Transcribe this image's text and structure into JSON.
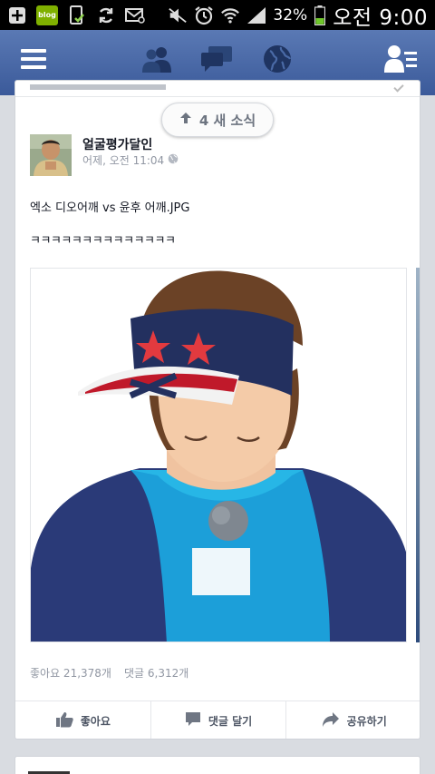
{
  "status_bar": {
    "battery": "32%",
    "time": "오전 9:00",
    "blog_badge": "blog"
  },
  "nav": {
    "icons": [
      "menu-icon",
      "friend-requests-icon",
      "messages-icon",
      "notifications-globe-icon",
      "right-sidebar-icon"
    ]
  },
  "new_stories": {
    "label": "4 새 소식"
  },
  "post": {
    "author": "얼굴평가달인",
    "time": "어제, 오전 11:04",
    "text_line1": "엑소 디오어깨 vs 윤후 어깨.JPG",
    "text_line2": "ㅋㅋㅋㅋㅋㅋㅋㅋㅋㅋㅋㅋㅋㅋ",
    "likes": "좋아요 21,378개",
    "comments": "댓글 6,312개",
    "actions": {
      "like": "좋아요",
      "comment": "댓글 달기",
      "share": "공유하기"
    }
  },
  "colors": {
    "nav_blue": "#3b5a9a",
    "page_bg": "#d9dce1",
    "muted_text": "#9197a3"
  }
}
